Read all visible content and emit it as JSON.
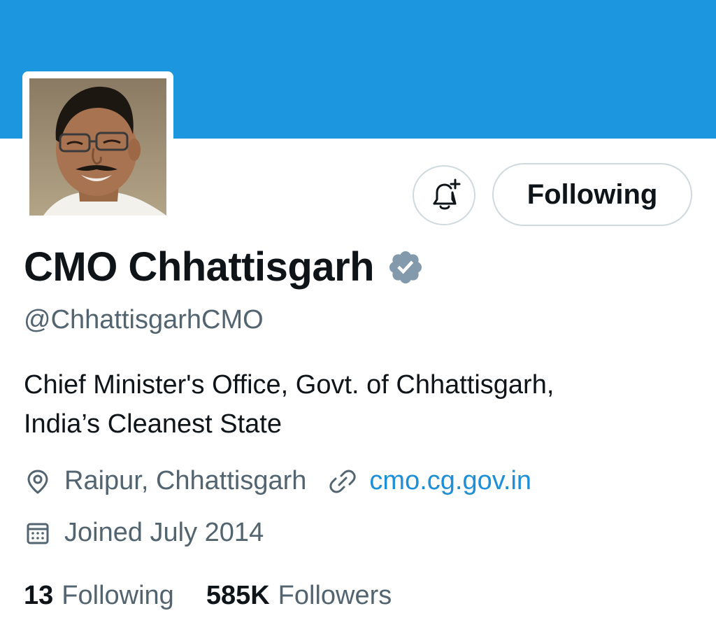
{
  "profile": {
    "display_name": "CMO Chhattisgarh",
    "handle": "@ChhattisgarhCMO",
    "verified": true,
    "bio_line_1": "Chief Minister's Office, Govt. of Chhattisgarh,",
    "bio_line_2": "India’s Cleanest State",
    "location": "Raipur, Chhattisgarh",
    "website": "cmo.cg.gov.in",
    "joined": "Joined July 2014"
  },
  "actions": {
    "follow_label": "Following",
    "notify_icon": "bell-plus-icon"
  },
  "stats": {
    "following_count": "13",
    "following_label": "Following",
    "followers_count": "585K",
    "followers_label": "Followers"
  },
  "icons": {
    "location": "location-pin-icon",
    "link": "link-icon",
    "joined": "calendar-icon",
    "verified": "verified-badge-icon"
  },
  "colors": {
    "banner": "#1d96e0",
    "link": "#1d8fd8",
    "secondary_text": "#536471",
    "primary_text": "#0f1419",
    "badge": "#829aab"
  }
}
